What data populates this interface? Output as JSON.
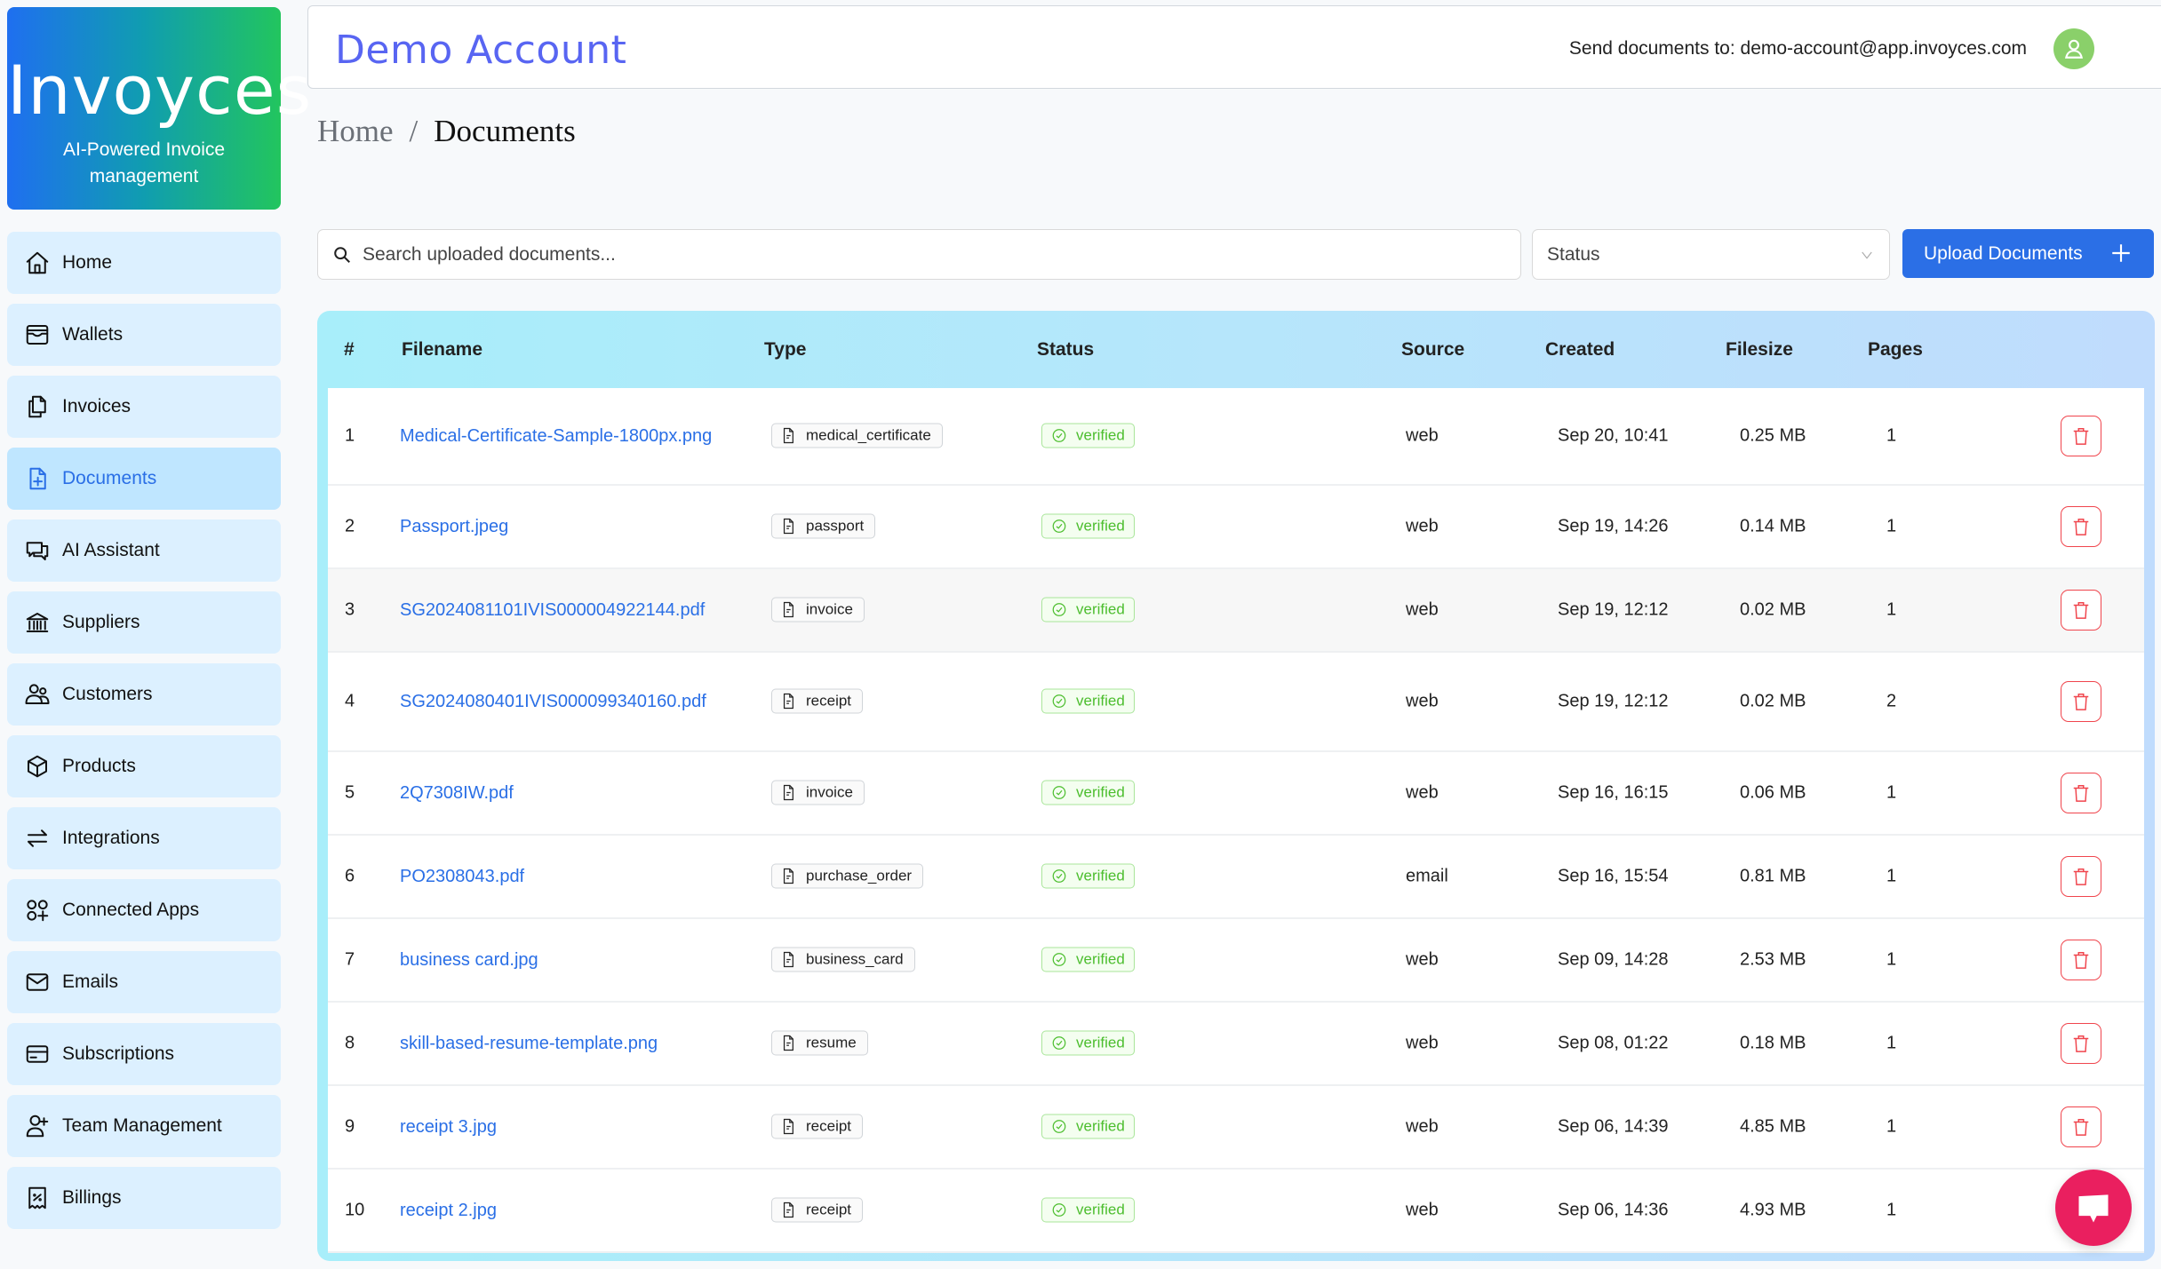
{
  "brand": {
    "name": "Invoyces",
    "tagline": "AI-Powered Invoice management",
    "gradient": [
      "#1f6ff0",
      "#22c55e"
    ]
  },
  "sidebar": {
    "items": [
      {
        "label": "Home",
        "icon": "home-icon",
        "active": false
      },
      {
        "label": "Wallets",
        "icon": "wallet-icon",
        "active": false
      },
      {
        "label": "Invoices",
        "icon": "files-icon",
        "active": false
      },
      {
        "label": "Documents",
        "icon": "file-plus-icon",
        "active": true
      },
      {
        "label": "AI Assistant",
        "icon": "chat-bubbles-icon",
        "active": false
      },
      {
        "label": "Suppliers",
        "icon": "bank-icon",
        "active": false
      },
      {
        "label": "Customers",
        "icon": "users-icon",
        "active": false
      },
      {
        "label": "Products",
        "icon": "cube-icon",
        "active": false
      },
      {
        "label": "Integrations",
        "icon": "arrows-exchange-icon",
        "active": false
      },
      {
        "label": "Connected Apps",
        "icon": "apps-add-icon",
        "active": false
      },
      {
        "label": "Emails",
        "icon": "mail-icon",
        "active": false
      },
      {
        "label": "Subscriptions",
        "icon": "credit-card-icon",
        "active": false
      },
      {
        "label": "Team Management",
        "icon": "user-plus-icon",
        "active": false
      },
      {
        "label": "Billings",
        "icon": "receipt-percent-icon",
        "active": false
      }
    ]
  },
  "header": {
    "title": "Demo Account",
    "send_label": "Send documents to: demo-account@app.invoyces.com",
    "avatar_icon": "user-icon",
    "accent": "#5865f2"
  },
  "breadcrumb": {
    "home": "Home",
    "separator": "/",
    "current": "Documents"
  },
  "toolbar": {
    "search_placeholder": "Search uploaded documents...",
    "search_value": "",
    "status_placeholder": "Status",
    "upload_label": "Upload Documents",
    "upload_color": "#2b6fe6"
  },
  "table": {
    "columns": [
      "#",
      "Filename",
      "Type",
      "Status",
      "Source",
      "Created",
      "Filesize",
      "Pages"
    ],
    "rows": [
      {
        "num": "1",
        "filename": "Medical-Certificate-Sample-1800px.png",
        "type": "medical_certificate",
        "status": "verified",
        "source": "web",
        "created": "Sep 20, 10:41",
        "filesize": "0.25 MB",
        "pages": "1"
      },
      {
        "num": "2",
        "filename": "Passport.jpeg",
        "type": "passport",
        "status": "verified",
        "source": "web",
        "created": "Sep 19, 14:26",
        "filesize": "0.14 MB",
        "pages": "1"
      },
      {
        "num": "3",
        "filename": "SG2024081101IVIS000004922144.pdf",
        "type": "invoice",
        "status": "verified",
        "source": "web",
        "created": "Sep 19, 12:12",
        "filesize": "0.02 MB",
        "pages": "1"
      },
      {
        "num": "4",
        "filename": "SG2024080401IVIS000099340160.pdf",
        "type": "receipt",
        "status": "verified",
        "source": "web",
        "created": "Sep 19, 12:12",
        "filesize": "0.02 MB",
        "pages": "2"
      },
      {
        "num": "5",
        "filename": "2Q7308IW.pdf",
        "type": "invoice",
        "status": "verified",
        "source": "web",
        "created": "Sep 16, 16:15",
        "filesize": "0.06 MB",
        "pages": "1"
      },
      {
        "num": "6",
        "filename": "PO2308043.pdf",
        "type": "purchase_order",
        "status": "verified",
        "source": "email",
        "created": "Sep 16, 15:54",
        "filesize": "0.81 MB",
        "pages": "1"
      },
      {
        "num": "7",
        "filename": "business card.jpg",
        "type": "business_card",
        "status": "verified",
        "source": "web",
        "created": "Sep 09, 14:28",
        "filesize": "2.53 MB",
        "pages": "1"
      },
      {
        "num": "8",
        "filename": "skill-based-resume-template.png",
        "type": "resume",
        "status": "verified",
        "source": "web",
        "created": "Sep 08, 01:22",
        "filesize": "0.18 MB",
        "pages": "1"
      },
      {
        "num": "9",
        "filename": "receipt 3.jpg",
        "type": "receipt",
        "status": "verified",
        "source": "web",
        "created": "Sep 06, 14:39",
        "filesize": "4.85 MB",
        "pages": "1"
      },
      {
        "num": "10",
        "filename": "receipt 2.jpg",
        "type": "receipt",
        "status": "verified",
        "source": "web",
        "created": "Sep 06, 14:36",
        "filesize": "4.93 MB",
        "pages": "1"
      }
    ],
    "status_color": "#4cbe2e",
    "delete_color": "#f0454d",
    "hovered_row": 2
  },
  "chat_widget": {
    "icon": "chat-icon",
    "color": "#ea1f5f"
  }
}
